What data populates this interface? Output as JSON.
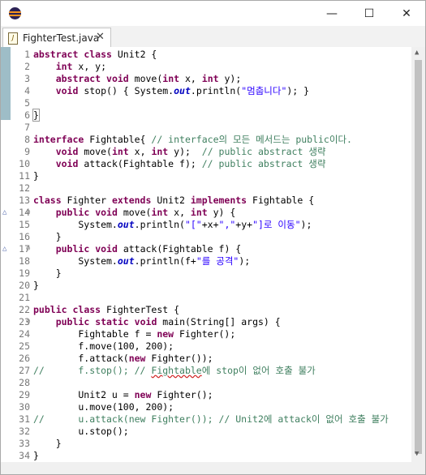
{
  "window": {
    "title_icon": "eclipse-icon",
    "minimize_glyph": "—",
    "maximize_glyph": "☐",
    "close_glyph": "✕"
  },
  "tab": {
    "label": "FighterTest.java",
    "close_glyph": "✕"
  },
  "colors": {
    "keyword": "#7f0055",
    "comment": "#3f7f5f",
    "string": "#2a00ff",
    "static_field": "#0000c0",
    "line_number": "#787878"
  },
  "lines": [
    {
      "n": "1",
      "segs": [
        {
          "t": "abstract",
          "c": "kw"
        },
        {
          "t": " "
        },
        {
          "t": "class",
          "c": "kw"
        },
        {
          "t": " Unit2 {"
        }
      ]
    },
    {
      "n": "2",
      "segs": [
        {
          "t": "    "
        },
        {
          "t": "int",
          "c": "kw"
        },
        {
          "t": " x, y;"
        }
      ]
    },
    {
      "n": "3",
      "segs": [
        {
          "t": "    "
        },
        {
          "t": "abstract",
          "c": "kw"
        },
        {
          "t": " "
        },
        {
          "t": "void",
          "c": "kw"
        },
        {
          "t": " move("
        },
        {
          "t": "int",
          "c": "kw"
        },
        {
          "t": " x, "
        },
        {
          "t": "int",
          "c": "kw"
        },
        {
          "t": " y);"
        }
      ]
    },
    {
      "n": "4",
      "segs": [
        {
          "t": "    "
        },
        {
          "t": "void",
          "c": "kw"
        },
        {
          "t": " stop() { System."
        },
        {
          "t": "out",
          "c": "fi"
        },
        {
          "t": ".println("
        },
        {
          "t": "\"멈춥니다\"",
          "c": "st"
        },
        {
          "t": "); }"
        }
      ]
    },
    {
      "n": "5",
      "segs": []
    },
    {
      "n": "6",
      "segs": [
        {
          "t": "}",
          "c": "box"
        }
      ]
    },
    {
      "n": "7",
      "segs": []
    },
    {
      "n": "8",
      "segs": [
        {
          "t": "interface",
          "c": "kw"
        },
        {
          "t": " Fightable{ "
        },
        {
          "t": "// interface의 모든 메서드는 public이다.",
          "c": "cm"
        }
      ]
    },
    {
      "n": "9",
      "segs": [
        {
          "t": "    "
        },
        {
          "t": "void",
          "c": "kw"
        },
        {
          "t": " move("
        },
        {
          "t": "int",
          "c": "kw"
        },
        {
          "t": " x, "
        },
        {
          "t": "int",
          "c": "kw"
        },
        {
          "t": " y);  "
        },
        {
          "t": "// public abstract 생략",
          "c": "cm"
        }
      ]
    },
    {
      "n": "10",
      "segs": [
        {
          "t": "    "
        },
        {
          "t": "void",
          "c": "kw"
        },
        {
          "t": " attack(Fightable f); "
        },
        {
          "t": "// public abstract 생략",
          "c": "cm"
        }
      ]
    },
    {
      "n": "11",
      "segs": [
        {
          "t": "}"
        }
      ]
    },
    {
      "n": "12",
      "segs": []
    },
    {
      "n": "13",
      "segs": [
        {
          "t": "class",
          "c": "kw"
        },
        {
          "t": " Fighter "
        },
        {
          "t": "extends",
          "c": "kw"
        },
        {
          "t": " Unit2 "
        },
        {
          "t": "implements",
          "c": "kw"
        },
        {
          "t": " Fightable {"
        }
      ]
    },
    {
      "n": "14",
      "marker": "△",
      "fold": "⊖",
      "segs": [
        {
          "t": "    "
        },
        {
          "t": "public",
          "c": "kw"
        },
        {
          "t": " "
        },
        {
          "t": "void",
          "c": "kw"
        },
        {
          "t": " move("
        },
        {
          "t": "int",
          "c": "kw"
        },
        {
          "t": " x, "
        },
        {
          "t": "int",
          "c": "kw"
        },
        {
          "t": " y) {"
        }
      ]
    },
    {
      "n": "15",
      "segs": [
        {
          "t": "        System."
        },
        {
          "t": "out",
          "c": "fi"
        },
        {
          "t": ".println("
        },
        {
          "t": "\"[\"",
          "c": "st"
        },
        {
          "t": "+x+"
        },
        {
          "t": "\",\"",
          "c": "st"
        },
        {
          "t": "+y+"
        },
        {
          "t": "\"]로 이동\"",
          "c": "st"
        },
        {
          "t": ");"
        }
      ]
    },
    {
      "n": "16",
      "segs": [
        {
          "t": "    }"
        }
      ]
    },
    {
      "n": "17",
      "marker": "△",
      "fold": "⊖",
      "segs": [
        {
          "t": "    "
        },
        {
          "t": "public",
          "c": "kw"
        },
        {
          "t": " "
        },
        {
          "t": "void",
          "c": "kw"
        },
        {
          "t": " attack(Fightable f) {"
        }
      ]
    },
    {
      "n": "18",
      "segs": [
        {
          "t": "        System."
        },
        {
          "t": "out",
          "c": "fi"
        },
        {
          "t": ".println(f+"
        },
        {
          "t": "\"를 공격\"",
          "c": "st"
        },
        {
          "t": ");"
        }
      ]
    },
    {
      "n": "19",
      "segs": [
        {
          "t": "    }"
        }
      ]
    },
    {
      "n": "20",
      "segs": [
        {
          "t": "}"
        }
      ]
    },
    {
      "n": "21",
      "segs": []
    },
    {
      "n": "22",
      "segs": [
        {
          "t": "public",
          "c": "kw"
        },
        {
          "t": " "
        },
        {
          "t": "class",
          "c": "kw"
        },
        {
          "t": " FighterTest {"
        }
      ]
    },
    {
      "n": "23",
      "fold": "⊖",
      "segs": [
        {
          "t": "    "
        },
        {
          "t": "public",
          "c": "kw"
        },
        {
          "t": " "
        },
        {
          "t": "static",
          "c": "kw"
        },
        {
          "t": " "
        },
        {
          "t": "void",
          "c": "kw"
        },
        {
          "t": " main(String[] args) {"
        }
      ]
    },
    {
      "n": "24",
      "segs": [
        {
          "t": "        Fightable f = "
        },
        {
          "t": "new",
          "c": "kw"
        },
        {
          "t": " Fighter();"
        }
      ]
    },
    {
      "n": "25",
      "segs": [
        {
          "t": "        f.move(100, 200);"
        }
      ]
    },
    {
      "n": "26",
      "segs": [
        {
          "t": "        f.attack("
        },
        {
          "t": "new",
          "c": "kw"
        },
        {
          "t": " Fighter());"
        }
      ]
    },
    {
      "n": "27",
      "segs": [
        {
          "t": "//      f.stop(); // ",
          "c": "cm"
        },
        {
          "t": "Fightable",
          "c": "cmsq"
        },
        {
          "t": "에 stop이 없어 호출 불가",
          "c": "cm"
        }
      ]
    },
    {
      "n": "28",
      "segs": []
    },
    {
      "n": "29",
      "segs": [
        {
          "t": "        Unit2 u = "
        },
        {
          "t": "new",
          "c": "kw"
        },
        {
          "t": " Fighter();"
        }
      ]
    },
    {
      "n": "30",
      "segs": [
        {
          "t": "        u.move(100, 200);"
        }
      ]
    },
    {
      "n": "31",
      "segs": [
        {
          "t": "//      u.attack(new Fighter()); // Unit2에 attack이 없어 호출 불가",
          "c": "cm"
        }
      ]
    },
    {
      "n": "32",
      "segs": [
        {
          "t": "        u.stop();"
        }
      ]
    },
    {
      "n": "33",
      "segs": [
        {
          "t": "    }"
        }
      ]
    },
    {
      "n": "34",
      "segs": [
        {
          "t": "}"
        }
      ]
    }
  ]
}
